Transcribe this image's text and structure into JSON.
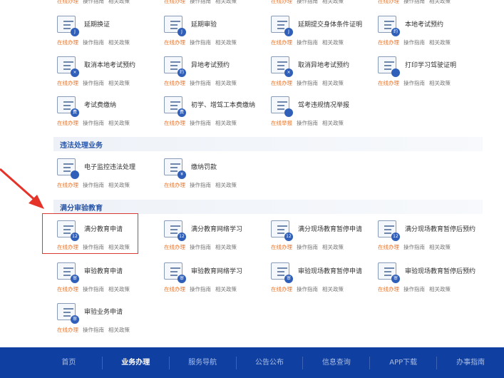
{
  "link_labels": {
    "online": "在线办理",
    "guide": "操作指南",
    "policy": "相关政策",
    "online_report": "在线举报"
  },
  "top_partial": 4,
  "group1": [
    {
      "title": "延期换证",
      "badge": "J"
    },
    {
      "title": "延期审验",
      "badge": "J"
    },
    {
      "title": "延期提交身体条件证明",
      "badge": "J"
    },
    {
      "title": "本地考试预约",
      "badge": "约"
    },
    {
      "title": "取消本地考试预约",
      "badge": "×"
    },
    {
      "title": "异地考试预约",
      "badge": "约"
    },
    {
      "title": "取消异地考试预约",
      "badge": "×"
    },
    {
      "title": "打印学习驾驶证明",
      "badge": ""
    },
    {
      "title": "考试费缴纳",
      "badge": "费"
    },
    {
      "title": "初学、增驾工本费缴纳",
      "badge": "费"
    },
    {
      "title": "驾考违规情况举报",
      "badge": "",
      "report": true
    }
  ],
  "section2": {
    "title": "违法处理业务",
    "items": [
      {
        "title": "电子监控违法处理",
        "badge": ""
      },
      {
        "title": "缴纳罚款",
        "badge": "¥"
      }
    ]
  },
  "section3": {
    "title": "满分审验教育",
    "items": [
      {
        "title": "满分教育申请",
        "badge": "12"
      },
      {
        "title": "满分教育网络学习",
        "badge": "12"
      },
      {
        "title": "满分现场教育暂停申请",
        "badge": "12"
      },
      {
        "title": "满分现场教育暂停后预约",
        "badge": "12"
      },
      {
        "title": "审验教育申请",
        "badge": "审"
      },
      {
        "title": "审验教育网络学习",
        "badge": "审"
      },
      {
        "title": "审验现场教育暂停申请",
        "badge": "审"
      },
      {
        "title": "审验现场教育暂停后预约",
        "badge": "审"
      },
      {
        "title": "审验业务申请",
        "badge": "审"
      }
    ]
  },
  "footer": {
    "items": [
      "首页",
      "业务办理",
      "服务导航",
      "公告公布",
      "信息查询",
      "APP下载",
      "办事指南"
    ],
    "active": 1
  },
  "colors": {
    "accent": "#2f5fb8",
    "orange": "#e8742a",
    "footer": "#0f3fa0",
    "highlight": "#d83a34"
  }
}
